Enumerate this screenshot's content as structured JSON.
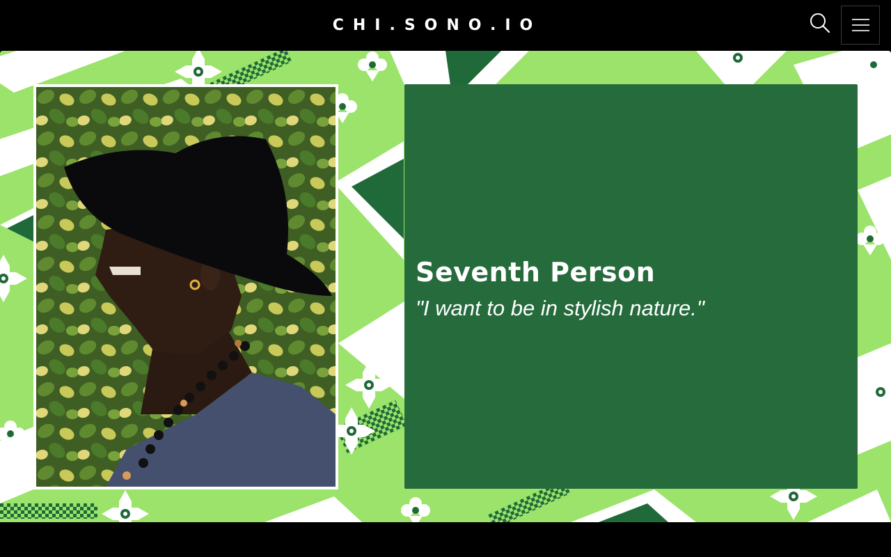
{
  "header": {
    "site_title": "CHI.SONO.IO",
    "search_icon": "search-icon",
    "menu_icon": "hamburger-menu-icon"
  },
  "profile": {
    "name": "Seventh Person",
    "quote": "\"I want to be in stylish nature.\""
  },
  "colors": {
    "pattern_light_green": "#9be36a",
    "pattern_dark_green": "#1f6a38",
    "card_green": "#256b3c",
    "header_bg": "#000000"
  }
}
